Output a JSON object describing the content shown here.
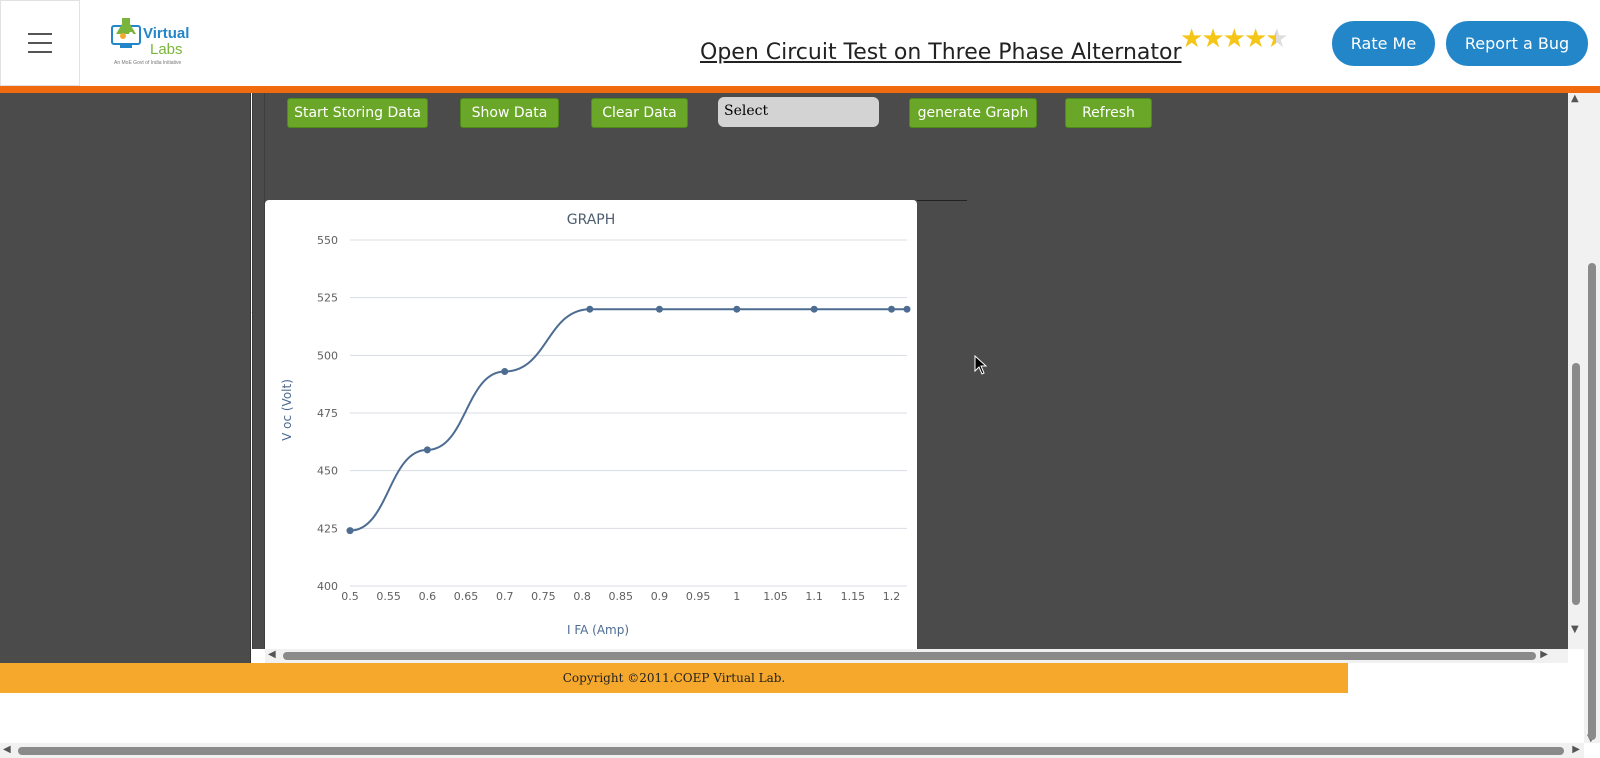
{
  "header": {
    "title": "Open Circuit Test on Three Phase Alternator",
    "logo_text_top": "Virtual",
    "logo_text_bottom": "Labs",
    "logo_tagline": "An MoE Govt of India Initiative",
    "rating": 4.5,
    "rate_label": "Rate Me",
    "bug_label": "Report a Bug"
  },
  "toolbar": {
    "start_label": "Start Storing Data",
    "show_label": "Show Data",
    "clear_label": "Clear Data",
    "select_value": "Select",
    "graph_label": "generate Graph",
    "refresh_label": "Refresh"
  },
  "footer": {
    "copyright": "Copyright ©2011.COEP Virtual Lab."
  },
  "colors": {
    "accent_orange": "#f06a10",
    "footer_orange": "#f5a82c",
    "button_blue": "#2386c8",
    "button_green": "#6aa728",
    "dark_bg": "#4b4b4b",
    "series_line": "#4d6c91"
  },
  "chart_data": {
    "type": "line",
    "title": "GRAPH",
    "xlabel": "I FA (Amp)",
    "ylabel": "V oc (Volt)",
    "xlim": [
      0.5,
      1.22
    ],
    "ylim": [
      400,
      550
    ],
    "xticks": [
      "0.5",
      "0.55",
      "0.6",
      "0.65",
      "0.7",
      "0.75",
      "0.8",
      "0.85",
      "0.9",
      "0.95",
      "1",
      "1.05",
      "1.1",
      "1.15",
      "1.2"
    ],
    "yticks": [
      "400",
      "425",
      "450",
      "475",
      "500",
      "525",
      "550"
    ],
    "grid": true,
    "series": [
      {
        "x": [
          0.5,
          0.6,
          0.7,
          0.81,
          0.9,
          1.0,
          1.1,
          1.2,
          1.22
        ],
        "y": [
          424,
          459,
          493,
          520,
          520,
          520,
          520,
          520,
          520
        ]
      }
    ]
  }
}
